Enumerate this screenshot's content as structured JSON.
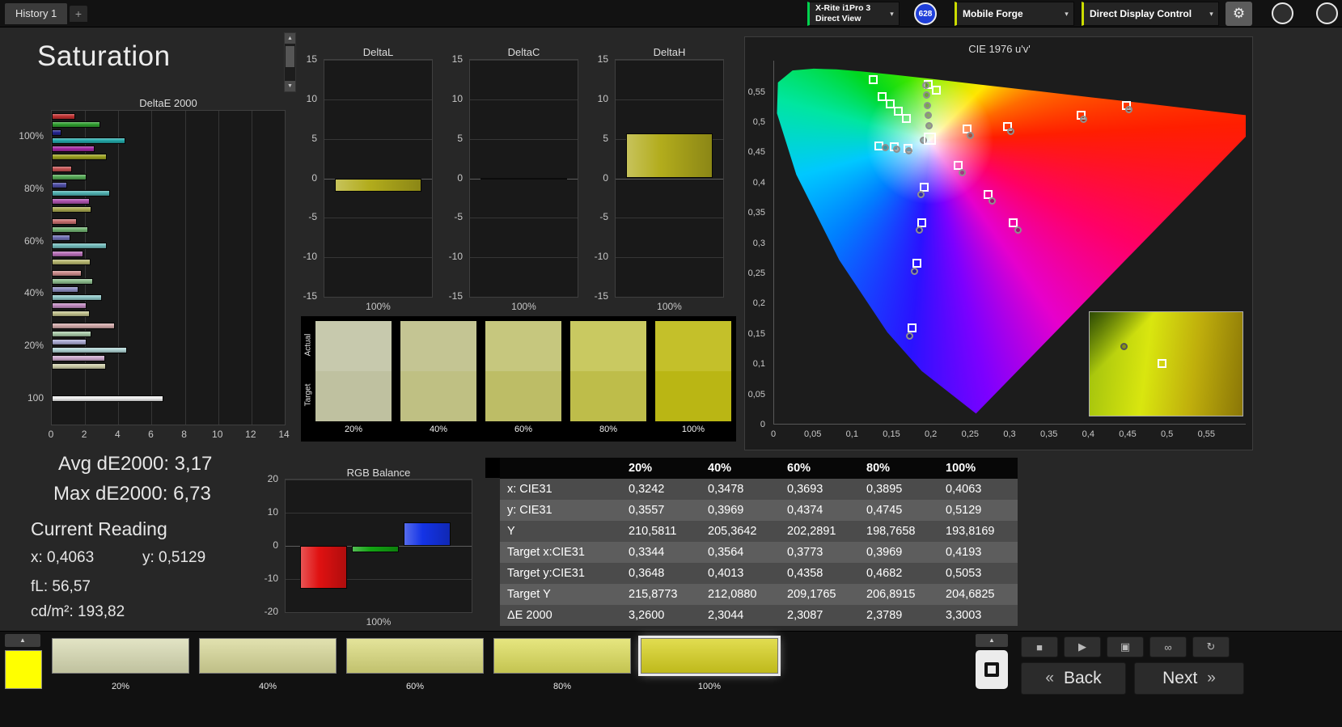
{
  "top_bar": {
    "history_tab": "History 1",
    "add_tab": "+",
    "meter_line1": "X-Rite i1Pro 3",
    "meter_line2": "Direct View",
    "meter_accent": "#00d24e",
    "badge": "628",
    "source_label": "Mobile Forge",
    "source_accent": "#ccdd00",
    "display_label": "Direct Display Control",
    "display_accent": "#ccdd00"
  },
  "saturation": {
    "title": "Saturation"
  },
  "stats": {
    "avg": "Avg dE2000: 3,17",
    "max": "Max dE2000: 6,73",
    "current_reading": "Current Reading",
    "x": "x: 0,4063",
    "y": "y: 0,5129",
    "fl": "fL: 56,57",
    "cdm2": "cd/m²: 193,82"
  },
  "swatch_panel": {
    "row_labels": [
      "Actual",
      "Target"
    ],
    "columns": [
      "20%",
      "40%",
      "60%",
      "80%",
      "100%"
    ],
    "actual_colors": [
      "#c7c9ad",
      "#c4c593",
      "#c6c77e",
      "#c9c961",
      "#c4c02a"
    ],
    "target_colors": [
      "#bfc1a0",
      "#bfc083",
      "#bdbd66",
      "#bebd4a",
      "#bab614"
    ]
  },
  "table": {
    "columns": [
      "",
      "20%",
      "40%",
      "60%",
      "80%",
      "100%"
    ],
    "rows": [
      {
        "label": "x: CIE31",
        "values": [
          "0,3242",
          "0,3478",
          "0,3693",
          "0,3895",
          "0,4063"
        ]
      },
      {
        "label": "y: CIE31",
        "values": [
          "0,3557",
          "0,3969",
          "0,4374",
          "0,4745",
          "0,5129"
        ]
      },
      {
        "label": "Y",
        "values": [
          "210,5811",
          "205,3642",
          "202,2891",
          "198,7658",
          "193,8169"
        ]
      },
      {
        "label": "Target x:CIE31",
        "values": [
          "0,3344",
          "0,3564",
          "0,3773",
          "0,3969",
          "0,4193"
        ]
      },
      {
        "label": "Target y:CIE31",
        "values": [
          "0,3648",
          "0,4013",
          "0,4358",
          "0,4682",
          "0,5053"
        ]
      },
      {
        "label": "Target Y",
        "values": [
          "215,8773",
          "212,0880",
          "209,1765",
          "206,8915",
          "204,6825"
        ]
      },
      {
        "label": "ΔE 2000",
        "values": [
          "3,2600",
          "2,3044",
          "2,3087",
          "2,3789",
          "3,3003"
        ]
      }
    ]
  },
  "bottom_bar": {
    "corner_swatch_color": "#ffff00",
    "swatches": [
      {
        "label": "20%",
        "color": "#dadcb4",
        "selected": false
      },
      {
        "label": "40%",
        "color": "#d9d999",
        "selected": false
      },
      {
        "label": "60%",
        "color": "#dcdc7d",
        "selected": false
      },
      {
        "label": "80%",
        "color": "#dfdf5c",
        "selected": false
      },
      {
        "label": "100%",
        "color": "#d9d31f",
        "selected": true
      }
    ],
    "back_label": "Back",
    "next_label": "Next"
  },
  "icons": {
    "gear": "⚙",
    "dropdown": "▾",
    "scroll_up": "▲",
    "scroll_down": "▼",
    "panel_up": "▲",
    "stop": "■",
    "play": "▶",
    "window": "▣",
    "infinity": "∞",
    "refresh": "↻",
    "back_chevron": "«",
    "next_chevron": "»"
  },
  "chart_data": [
    {
      "id": "deltae2000",
      "type": "bar",
      "orientation": "horizontal",
      "title": "DeltaE 2000",
      "xlim": [
        0,
        14
      ],
      "x_ticks": [
        0,
        2,
        4,
        6,
        8,
        10,
        12,
        14
      ],
      "groups": [
        {
          "label": "100%",
          "bars": [
            {
              "color": "#c03030",
              "value": 1.4
            },
            {
              "color": "#2f9e2f",
              "value": 2.9
            },
            {
              "color": "#24248e",
              "value": 0.6
            },
            {
              "color": "#23a8a8",
              "value": 4.4
            },
            {
              "color": "#a328a3",
              "value": 2.6
            },
            {
              "color": "#9aa020",
              "value": 3.3
            }
          ]
        },
        {
          "label": "80%",
          "bars": [
            {
              "color": "#c35252",
              "value": 1.2
            },
            {
              "color": "#54a854",
              "value": 2.1
            },
            {
              "color": "#4c4ca4",
              "value": 0.9
            },
            {
              "color": "#4fb0b0",
              "value": 3.5
            },
            {
              "color": "#ad52ad",
              "value": 2.3
            },
            {
              "color": "#a8a84e",
              "value": 2.38
            }
          ]
        },
        {
          "label": "60%",
          "bars": [
            {
              "color": "#c76e6e",
              "value": 1.5
            },
            {
              "color": "#72b272",
              "value": 2.2
            },
            {
              "color": "#6e6eb2",
              "value": 1.1
            },
            {
              "color": "#72baba",
              "value": 3.3
            },
            {
              "color": "#b66eb6",
              "value": 1.9
            },
            {
              "color": "#b4b46e",
              "value": 2.31
            }
          ]
        },
        {
          "label": "40%",
          "bars": [
            {
              "color": "#cb8a8a",
              "value": 1.8
            },
            {
              "color": "#8cbc8c",
              "value": 2.5
            },
            {
              "color": "#8c8cc0",
              "value": 1.6
            },
            {
              "color": "#8ec6c6",
              "value": 3.0
            },
            {
              "color": "#c08ac0",
              "value": 2.1
            },
            {
              "color": "#c0c08c",
              "value": 2.3
            }
          ]
        },
        {
          "label": "20%",
          "bars": [
            {
              "color": "#d0a8a8",
              "value": 3.8
            },
            {
              "color": "#a8c8a8",
              "value": 2.4
            },
            {
              "color": "#a8a8d0",
              "value": 2.1
            },
            {
              "color": "#aed2d2",
              "value": 4.5
            },
            {
              "color": "#cca8cc",
              "value": 3.2
            },
            {
              "color": "#cccca8",
              "value": 3.26
            }
          ]
        },
        {
          "label": "100",
          "bars": [
            {
              "color": "#ebebeb",
              "value": 6.73
            }
          ]
        }
      ]
    },
    {
      "id": "deltaL",
      "type": "bar",
      "title": "DeltaL",
      "ylim": [
        -15,
        15
      ],
      "y_ticks": [
        "15",
        "10",
        "5",
        "0",
        "-5",
        "-10",
        "-15"
      ],
      "category": "100%",
      "value": -1.7,
      "bar_color": "#b2ac1c"
    },
    {
      "id": "deltaC",
      "type": "bar",
      "title": "DeltaC",
      "ylim": [
        -15,
        15
      ],
      "y_ticks": [
        "15",
        "10",
        "5",
        "0",
        "-5",
        "-10",
        "-15"
      ],
      "category": "100%",
      "value": 0,
      "bar_color": "#b2ac1c"
    },
    {
      "id": "deltaH",
      "type": "bar",
      "title": "DeltaH",
      "ylim": [
        -15,
        15
      ],
      "y_ticks": [
        "15",
        "10",
        "5",
        "0",
        "-5",
        "-10",
        "-15"
      ],
      "category": "100%",
      "value": 5.7,
      "bar_color": "#b2ac1c"
    },
    {
      "id": "rgb_balance",
      "type": "bar",
      "title": "RGB Balance",
      "ylim": [
        -20,
        20
      ],
      "y_ticks": [
        "20",
        "10",
        "0",
        "-10",
        "-20"
      ],
      "category": "100%",
      "bars": [
        {
          "name": "red",
          "color": "#e01111",
          "value": -13
        },
        {
          "name": "green",
          "color": "#12a312",
          "value": -2
        },
        {
          "name": "blue",
          "color": "#1433e6",
          "value": 7
        }
      ]
    },
    {
      "id": "cie",
      "type": "scatter",
      "title": "CIE 1976 u'v'",
      "x_tick_labels": [
        "0",
        "0,05",
        "0,1",
        "0,15",
        "0,2",
        "0,25",
        "0,3",
        "0,35",
        "0,4",
        "0,45",
        "0,5",
        "0,55"
      ],
      "y_tick_labels": [
        "0",
        "0,05",
        "0,1",
        "0,15",
        "0,2",
        "0,25",
        "0,3",
        "0,35",
        "0,4",
        "0,45",
        "0,5",
        "0,55"
      ],
      "xlim": [
        0,
        0.6
      ],
      "ylim": [
        0,
        0.6016
      ],
      "white_point": [
        0.198,
        0.472
      ],
      "targets": [
        [
          0.126,
          0.57
        ],
        [
          0.196,
          0.562
        ],
        [
          0.206,
          0.553
        ],
        [
          0.137,
          0.542
        ],
        [
          0.147,
          0.53
        ],
        [
          0.158,
          0.518
        ],
        [
          0.168,
          0.506
        ],
        [
          0.133,
          0.461
        ],
        [
          0.153,
          0.459
        ],
        [
          0.17,
          0.456
        ],
        [
          0.245,
          0.489
        ],
        [
          0.296,
          0.492
        ],
        [
          0.39,
          0.512
        ],
        [
          0.447,
          0.528
        ],
        [
          0.234,
          0.429
        ],
        [
          0.272,
          0.381
        ],
        [
          0.304,
          0.334
        ],
        [
          0.191,
          0.392
        ],
        [
          0.188,
          0.334
        ],
        [
          0.181,
          0.267
        ],
        [
          0.175,
          0.16
        ]
      ],
      "measurements": [
        [
          0.193,
          0.561
        ],
        [
          0.194,
          0.545
        ],
        [
          0.195,
          0.528
        ],
        [
          0.196,
          0.511
        ],
        [
          0.197,
          0.494
        ],
        [
          0.141,
          0.458
        ],
        [
          0.156,
          0.455
        ],
        [
          0.171,
          0.452
        ],
        [
          0.19,
          0.47
        ],
        [
          0.249,
          0.478
        ],
        [
          0.3,
          0.484
        ],
        [
          0.393,
          0.505
        ],
        [
          0.45,
          0.521
        ],
        [
          0.239,
          0.417
        ],
        [
          0.277,
          0.369
        ],
        [
          0.31,
          0.322
        ],
        [
          0.186,
          0.38
        ],
        [
          0.184,
          0.322
        ],
        [
          0.178,
          0.254
        ],
        [
          0.172,
          0.147
        ]
      ],
      "inset": {
        "circle": [
          0.22,
          0.33
        ],
        "square": [
          0.47,
          0.49
        ]
      }
    }
  ]
}
